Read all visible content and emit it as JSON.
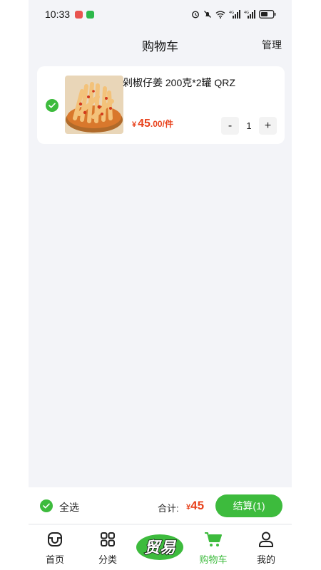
{
  "status_bar": {
    "time": "10:33"
  },
  "header": {
    "title": "购物车",
    "manage_label": "管理"
  },
  "cart": {
    "items": [
      {
        "name": "剁椒仔姜 200克*2罐 QRZ",
        "price_symbol": "¥",
        "price_int": "45",
        "price_dec": ".00",
        "unit": "/件",
        "quantity": "1",
        "minus_label": "-",
        "plus_label": "+",
        "checked": true
      }
    ]
  },
  "bottom_bar": {
    "select_all_label": "全选",
    "total_label": "合计:",
    "total_symbol": "¥",
    "total_value": "45",
    "checkout_label": "结算(1)"
  },
  "tabbar": {
    "tabs": [
      {
        "label": "首页",
        "icon": "home-icon"
      },
      {
        "label": "分类",
        "icon": "category-icon"
      },
      {
        "label": "",
        "icon": "brand-logo"
      },
      {
        "label": "购物车",
        "icon": "cart-icon",
        "active": true
      },
      {
        "label": "我的",
        "icon": "profile-icon"
      }
    ],
    "brand_text": "贸易"
  },
  "colors": {
    "accent": "#3dbb3d",
    "price": "#e8421c",
    "background": "#f3f4f8"
  }
}
